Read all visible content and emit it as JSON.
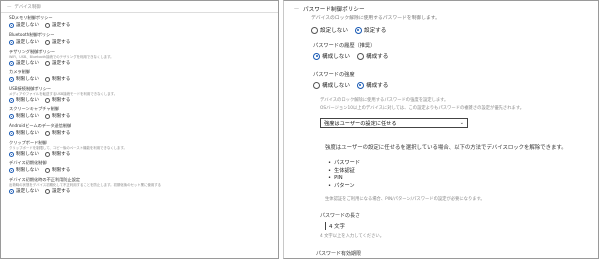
{
  "left": {
    "title": "デバイス制御",
    "sections": [
      {
        "title": "SDメモリ制御ポリシー",
        "desc": "",
        "options": [
          "設定しない",
          "設定する"
        ],
        "selected": 0
      },
      {
        "title": "Bluetooth制御ポリシー",
        "desc": "",
        "options": [
          "設定しない",
          "設定する"
        ],
        "selected": 0
      },
      {
        "title": "テザリング制御ポリシー",
        "desc": "WiFi、USB、Bluetooth接続でのテザリングを利用できなくします。",
        "options": [
          "設定しない",
          "設定する"
        ],
        "selected": 0
      },
      {
        "title": "カメラ制御",
        "desc": "",
        "options": [
          "制限しない",
          "制限する"
        ],
        "selected": 0
      },
      {
        "title": "USB接続制御ポリシー",
        "desc": "メディアやファイルを転送するUSB接続モードを利用できなくします。",
        "options": [
          "制限しない",
          "制限する"
        ],
        "selected": 0
      },
      {
        "title": "スクリーンキャプチャ制御",
        "desc": "",
        "options": [
          "制限しない",
          "制限する"
        ],
        "selected": 0
      },
      {
        "title": "Androidビームのデータ送信制御",
        "desc": "",
        "options": [
          "制限しない",
          "制限する"
        ],
        "selected": 0
      },
      {
        "title": "クリップボード制御",
        "desc": "クリップボードを制限して、コピー後のペースト機能を利用できなくします。",
        "options": [
          "制限しない",
          "制限する"
        ],
        "selected": 0
      },
      {
        "title": "デバイス初期化制御",
        "desc": "",
        "options": [
          "制限しない",
          "制限する"
        ],
        "selected": 0
      },
      {
        "title": "デバイス初期化時の不正利用防止設定",
        "desc": "出荷時の状態をデバイス初期化して不正利用することを防止します。初期化後のセット業に使用する",
        "options": [
          "設定しない",
          "設定する"
        ],
        "selected": 0
      }
    ]
  },
  "right": {
    "title": "パスワード制御ポリシー",
    "desc": "デバイスのロック解除に使用するパスワードを制御します。",
    "main_options": [
      "設定しない",
      "設定する"
    ],
    "main_selected": 1,
    "history_label": "パスワードの履歴（推奨）",
    "history_options": [
      "構成しない",
      "構成する"
    ],
    "history_selected": 0,
    "strength_label": "パスワードの強度",
    "strength_options": [
      "構成しない",
      "構成する"
    ],
    "strength_selected": 1,
    "strength_desc1": "デバイスのロック解除に使用するパスワードの強度を設定します。",
    "strength_desc2": "OSバージョン10以上のデバイスに対しては、この設定よりもパスワードの複雑さの設定が優先されます。",
    "select_value": "強度はユーザーの設定に任せる",
    "info_text": "強度はユーザーの設定に任せるを選択している場合、以下の方法でデバイスロックを解除できます。",
    "unlock_methods": [
      "パスワード",
      "生体認証",
      "PIN",
      "パターン"
    ],
    "bio_note": "生体認証をご利用になる場合、PIN/パターン/パスワードの設定が必要になります。",
    "length_label": "パスワードの長さ",
    "length_value": "4 文字",
    "length_hint": "4 文字以上を入力してください。",
    "expiry_label": "パスワード有効期限"
  }
}
